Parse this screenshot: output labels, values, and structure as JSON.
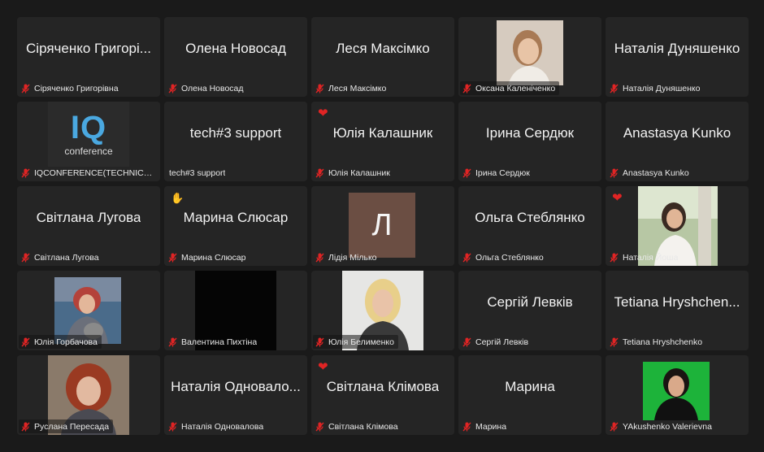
{
  "participants": [
    {
      "big": "Сіряченко Григорі...",
      "label": "Сіряченко Григорівна"
    },
    {
      "big": "Олена Новосад",
      "label": "Олена Новосад"
    },
    {
      "big": "Леся Максімко",
      "label": "Леся Максімко"
    },
    {
      "label": "Оксана Каленіченко"
    },
    {
      "big": "Наталія Дуняшенко",
      "label": "Наталія Дуняшенко"
    },
    {
      "logo_main": "IQ",
      "logo_sub": "conference",
      "label": "IQCONFERENCE(TECHNICAL..."
    },
    {
      "big": "tech#3 support",
      "label": "tech#3 support"
    },
    {
      "big": "Юлія Калашник",
      "label": "Юлія Калашник",
      "reaction": "heart-icon"
    },
    {
      "big": "Ірина Сердюк",
      "label": "Ірина Сердюк"
    },
    {
      "big": "Anastasya Kunko",
      "label": "Anastasya Kunko"
    },
    {
      "big": "Світлана Лугова",
      "label": "Світлана Лугова"
    },
    {
      "big": "Марина Слюсар",
      "label": "Марина Слюсар",
      "reaction": "clapping-hands-icon"
    },
    {
      "avatar_letter": "Л",
      "label": "Лідія Мілько"
    },
    {
      "big": "Ольга Стеблянко",
      "label": "Ольга Стеблянко"
    },
    {
      "label": "Наталія Йоша",
      "reaction": "heart-icon"
    },
    {
      "label": "Юлія Горбачова"
    },
    {
      "label": "Валентина Пихтіна"
    },
    {
      "label": "Юлія Белименко"
    },
    {
      "big": "Сергій Левків",
      "label": "Сергій Левків"
    },
    {
      "big": "Tetiana Hryshchen...",
      "label": "Tetiana Hryshchenko"
    },
    {
      "label": "Руслана Пересада"
    },
    {
      "big": "Наталія Одновало...",
      "label": "Наталія Одновалова"
    },
    {
      "big": "Світлана Клімова",
      "label": "Світлана Клімова",
      "reaction": "heart-icon"
    },
    {
      "big": "Марина",
      "label": "Марина"
    },
    {
      "label": "YAkushenko Valerievna"
    }
  ],
  "colors": {
    "background": "#1a1a1a",
    "tile": "#252525",
    "muted_mic": "#e02424",
    "heart": "#e02424"
  }
}
